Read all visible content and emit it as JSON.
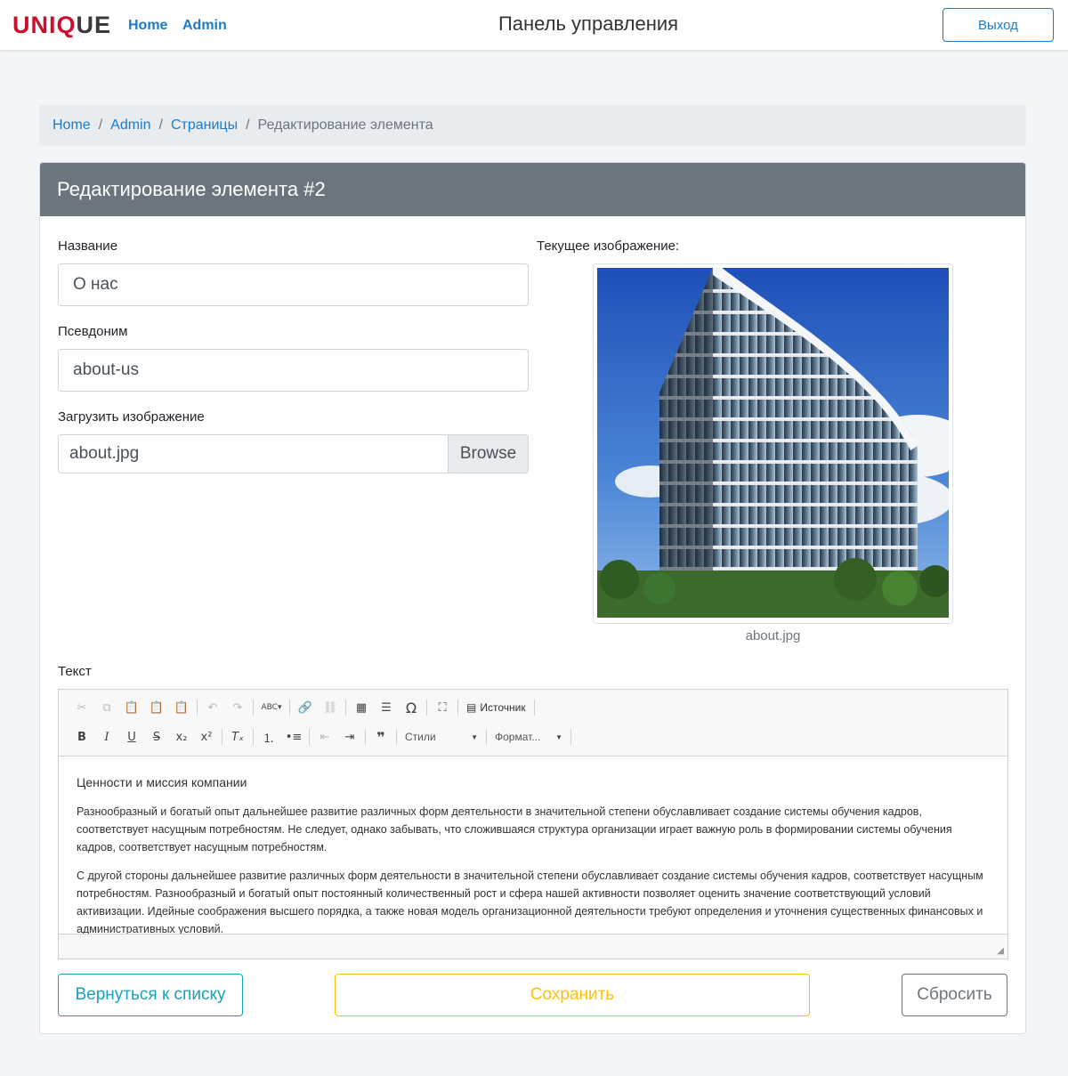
{
  "navbar": {
    "logo_part1": "UNIQ",
    "logo_part2": "UE",
    "links": [
      {
        "label": "Home"
      },
      {
        "label": "Admin"
      }
    ],
    "title": "Панель управления",
    "logout_label": "Выход"
  },
  "breadcrumb": {
    "items": [
      {
        "label": "Home"
      },
      {
        "label": "Admin"
      },
      {
        "label": "Страницы"
      }
    ],
    "separator": "/",
    "active": "Редактирование элемента"
  },
  "card": {
    "title": "Редактирование элемента #2"
  },
  "form": {
    "name_label": "Название",
    "name_value": "О нас",
    "alias_label": "Псевдоним",
    "alias_value": "about-us",
    "upload_label": "Загрузить изображение",
    "upload_value": "about.jpg",
    "browse_label": "Browse",
    "current_image_label": "Текущее изображение:",
    "current_image_caption": "about.jpg",
    "text_label": "Текст"
  },
  "editor": {
    "source_label": "Источник",
    "styles_label": "Стили",
    "format_label": "Формат...",
    "content": {
      "heading": "Ценности и миссия компании",
      "paragraphs": [
        "Разнообразный и богатый опыт дальнейшее развитие различных форм деятельности в значительной степени обуславливает создание системы обучения кадров, соответствует насущным потребностям. Не следует, однако забывать, что сложившаяся структура организации играет важную роль в формировании системы обучения кадров, соответствует насущным потребностям.",
        "С другой стороны дальнейшее развитие различных форм деятельности в значительной степени обуславливает создание системы обучения кадров, соответствует насущным потребностям. Разнообразный и богатый опыт постоянный количественный рост и сфера нашей активности позволяет оценить значение соответствующий условий активизации. Идейные соображения высшего порядка, а также новая модель организационной деятельности требуют определения и уточнения существенных финансовых и административных условий."
      ]
    }
  },
  "buttons": {
    "back": "Вернуться к списку",
    "save": "Сохранить",
    "reset": "Сбросить"
  },
  "colors": {
    "primary": "#1e7bc4",
    "brand_red": "#c8102e",
    "card_header": "#6c757d",
    "info": "#17a2b8",
    "warning": "#ffc107",
    "secondary": "#6c757d"
  }
}
